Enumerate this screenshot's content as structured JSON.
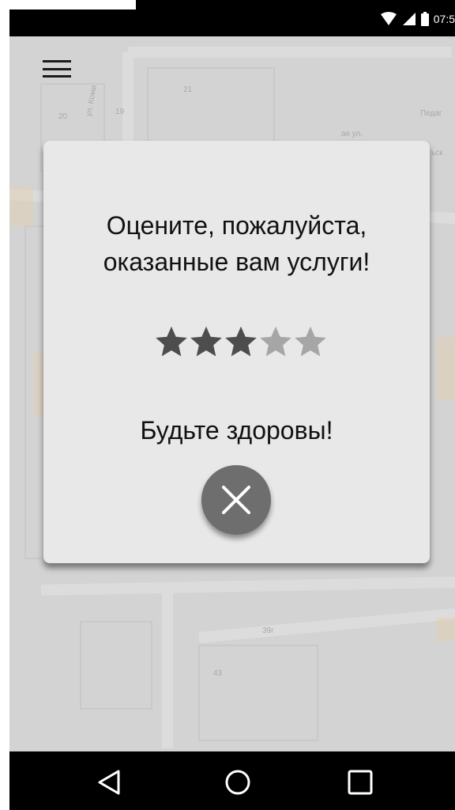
{
  "status_bar": {
    "time": "07:5",
    "icons": [
      "wifi-icon",
      "signal-icon",
      "battery-icon"
    ]
  },
  "map": {
    "labels": [
      "20",
      "19",
      "21",
      "ул. Коми",
      "Педаг",
      "ая ул.",
      "ьск",
      "39г",
      "43"
    ]
  },
  "menu": {
    "icon": "hamburger-menu-icon"
  },
  "dialog": {
    "title": "Оцените, пожалуйста,\nоказанные вам услуги!",
    "rating": {
      "value": 3,
      "max": 5,
      "filled_color": "#4d4d4d",
      "empty_color": "#a6a6a6"
    },
    "farewell": "Будьте здоровы!",
    "close_icon": "close-icon",
    "close_button_color": "#6e6e6e"
  },
  "nav_bar": {
    "buttons": [
      "back-icon",
      "home-icon",
      "recents-icon"
    ]
  }
}
